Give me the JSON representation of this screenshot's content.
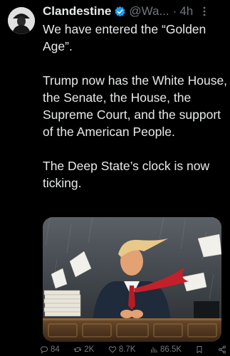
{
  "tweet": {
    "display_name": "Clandestine",
    "handle": "@Wa...",
    "separator": "·",
    "time": "4h",
    "paragraphs": [
      "We have entered the “Golden Age”.",
      "Trump now has the White House, the Senate, the House, the Supreme Court, and the support of the American People.",
      "The Deep State’s clock is now ticking."
    ]
  },
  "actions": {
    "replies": "84",
    "reposts": "2K",
    "likes": "8.7K",
    "views": "86.5K"
  },
  "icons": {
    "verified": "verified-badge-icon",
    "more": "more-vertical-icon",
    "reply": "reply-icon",
    "repost": "repost-icon",
    "like": "heart-icon",
    "views": "views-chart-icon",
    "bookmark": "bookmark-icon",
    "share": "share-icon"
  },
  "colors": {
    "background": "#000000",
    "text": "#e7e9ea",
    "muted": "#71767b",
    "verified": "#1d9bf0"
  }
}
